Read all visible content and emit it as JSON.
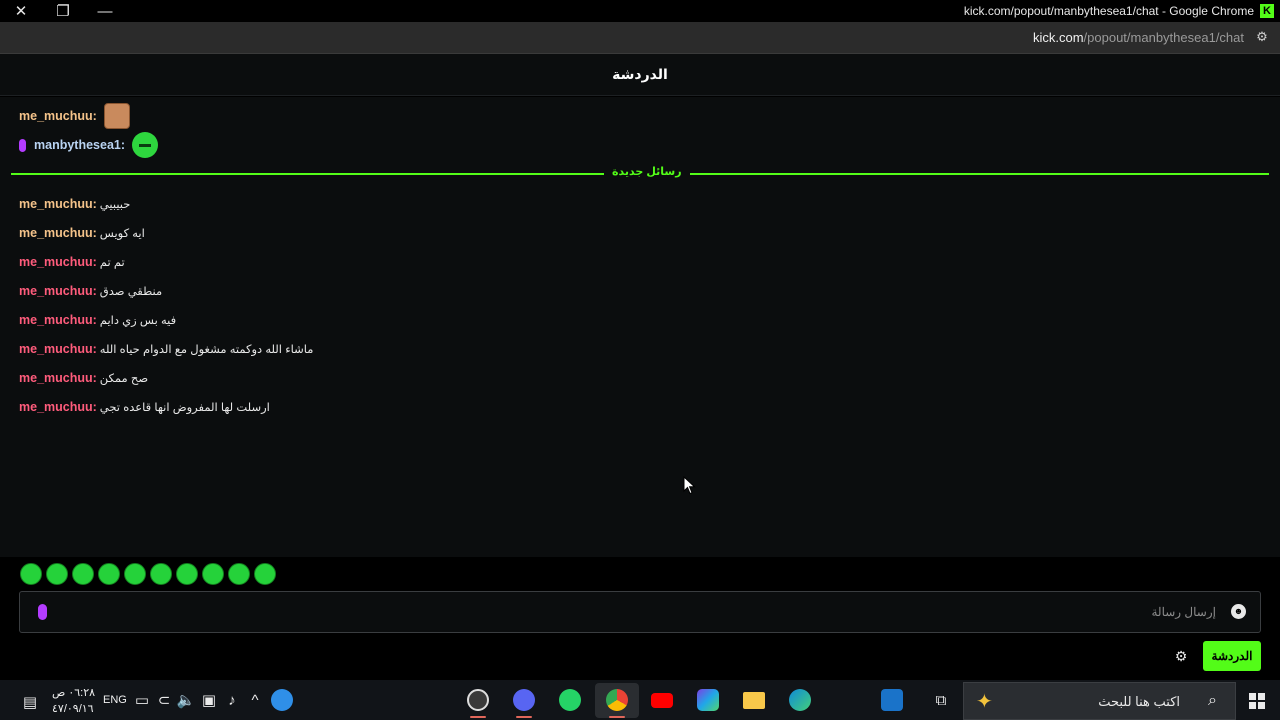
{
  "window": {
    "title": "kick.com/popout/manbythesea1/chat - Google Chrome",
    "favicon": "K",
    "controls": [
      "close-icon",
      "restore-icon",
      "minimize-icon"
    ]
  },
  "address": {
    "host": "kick.com",
    "path": "/popout/manbythesea1/chat",
    "site_settings_icon": "tune-icon"
  },
  "chat": {
    "header": "الدردشة",
    "new_messages_label": "رسائل جديدة",
    "top_messages": [
      {
        "user": "me_muchuu:",
        "user_color": "#f5c38a",
        "emote": "brown-emote"
      },
      {
        "user": "manbythesea1:",
        "user_color": "#b9d3f2",
        "emote": "green-emote"
      }
    ],
    "messages": [
      {
        "user": "me_muchuu:",
        "user_color": "#f5c38a",
        "text": "حبيبيي"
      },
      {
        "user": "me_muchuu:",
        "user_color": "#f5c38a",
        "text": "ايه كويس"
      },
      {
        "user": "me_muchuu:",
        "user_color": "#ff5c7c",
        "text": "تم تم"
      },
      {
        "user": "me_muchuu:",
        "user_color": "#ff5c7c",
        "text": "منطقي صدق"
      },
      {
        "user": "me_muchuu:",
        "user_color": "#ff5c7c",
        "text": "فيه بس زي دايم"
      },
      {
        "user": "me_muchuu:",
        "user_color": "#ff5c7c",
        "text": "ماشاء الله دوكمته مشغول مع الدوام حياه الله"
      },
      {
        "user": "me_muchuu:",
        "user_color": "#ff5c7c",
        "text": "صح ممكن"
      },
      {
        "user": "me_muchuu:",
        "user_color": "#ff5c7c",
        "text": "ارسلت لها المفروض انها قاعده تجي"
      }
    ],
    "input_placeholder": "إرسال رسالة",
    "send_button": "الدردشة",
    "accent": "#53fc18"
  },
  "taskbar": {
    "time": "٠٦:٢٨ ص",
    "date": "٤٧/٠٩/١٦",
    "lang": "ENG",
    "search_placeholder": "اكتب هنا للبحث"
  }
}
